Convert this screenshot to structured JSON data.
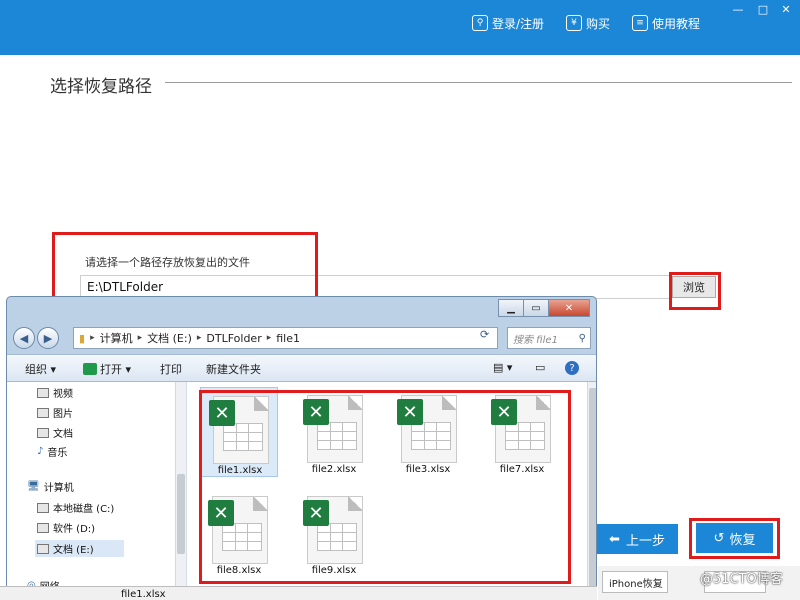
{
  "topbar": {
    "login_label": "登录/注册",
    "buy_label": "购买",
    "tutorial_label": "使用教程",
    "window_controls": [
      "—",
      "□",
      "✕"
    ]
  },
  "section_title": "选择恢复路径",
  "path": {
    "label": "请选择一个路径存放恢复出的文件",
    "value": "E:\\DTLFolder",
    "browse_label": "浏览"
  },
  "buttons": {
    "prev_label": "上一步",
    "recover_label": "恢复"
  },
  "bottom_tabs": {
    "iphone_label": "iPhone恢复"
  },
  "watermark": "@51CTO博客",
  "dialog": {
    "breadcrumb": [
      "计算机",
      "文档 (E:)",
      "DTLFolder",
      "file1"
    ],
    "search_placeholder": "搜索 file1",
    "toolbar": {
      "organize": "组织 ▾",
      "open": "打开 ▾",
      "print": "打印",
      "new_folder": "新建文件夹"
    },
    "nav_items": [
      "视频",
      "图片",
      "文档",
      "音乐",
      "计算机",
      "本地磁盘 (C:)",
      "软件 (D:)",
      "文档 (E:)",
      "网络"
    ],
    "files": [
      "file1.xlsx",
      "file2.xlsx",
      "file3.xlsx",
      "file7.xlsx",
      "file8.xlsx",
      "file9.xlsx"
    ],
    "filename_field": "file1.xlsx"
  },
  "colors": {
    "brand_blue": "#1b87d6",
    "highlight_red": "#e01b1b",
    "excel_green": "#1f7d3f"
  }
}
